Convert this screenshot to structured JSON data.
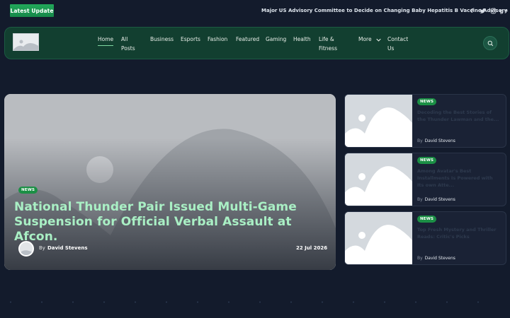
{
  "topbar": {
    "latest_label": "Latest Update",
    "ticker_text": "Major US Advisory Committee to Decide on Changing Baby Hepatitis B Vaccine Advisory",
    "socials": [
      {
        "icon": "facebook-icon",
        "glyph": "f"
      },
      {
        "icon": "twitter-icon",
        "glyph": ""
      },
      {
        "icon": "instagram-icon",
        "glyph": ""
      },
      {
        "icon": "google-plus-icon",
        "glyph": "g+"
      }
    ]
  },
  "nav": {
    "items": [
      {
        "label": "Home",
        "active": true
      },
      {
        "label": "All Posts"
      },
      {
        "label": "Business"
      },
      {
        "label": "Esports"
      },
      {
        "label": "Fashion"
      },
      {
        "label": "Featured"
      },
      {
        "label": "Gaming"
      },
      {
        "label": "Health"
      },
      {
        "label": "Life & Fitness"
      },
      {
        "label": "More"
      },
      {
        "label": "Contact Us"
      }
    ]
  },
  "hero": {
    "badge": "NEWS",
    "title": "National Thunder Pair Issued Multi-Game Suspension for Official Verbal Assault at Afcon.",
    "by_prefix": "By",
    "author": "David Stevens",
    "date": "22 Jul 2026"
  },
  "side_cards": [
    {
      "badge": "NEWS",
      "title": "Decoding the Best Stories of the Thunder Lawman and the...",
      "by_prefix": "By",
      "author": "David Stevens"
    },
    {
      "badge": "NEWS",
      "title": "Among Avatar's Best Installments Is Powered with Its own Atte...",
      "by_prefix": "By",
      "author": "David Stevens"
    },
    {
      "badge": "NEWS",
      "title": "Top Fresh Mystery and Thriller Reads: Critic's Picks",
      "by_prefix": "By",
      "author": "David Stevens"
    }
  ],
  "colors": {
    "background": "#131b2c",
    "accent_green": "#1b8f45",
    "nav_bg": "#123f30",
    "hero_title": "#a9efc4"
  }
}
